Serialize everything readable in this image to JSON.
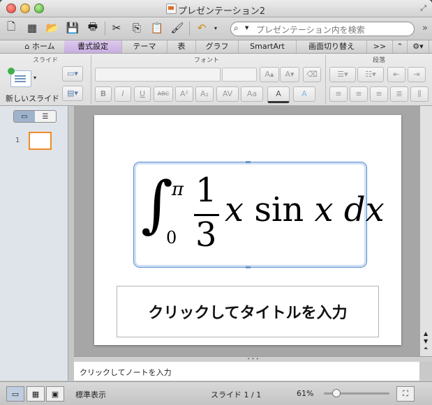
{
  "window": {
    "title": "プレゼンテーション2"
  },
  "toolbar": {
    "search_placeholder": "プレゼンテーション内を検索",
    "more_glyph": "»"
  },
  "tabs": [
    {
      "label": "ホーム"
    },
    {
      "label": "書式設定"
    },
    {
      "label": "テーマ"
    },
    {
      "label": "表"
    },
    {
      "label": "グラフ"
    },
    {
      "label": "SmartArt"
    },
    {
      "label": "画面切り替え"
    },
    {
      "label": ">>"
    }
  ],
  "ribbon": {
    "slides_group": "スライド",
    "font_group": "フォント",
    "paragraph_group": "段落",
    "new_slide_label": "新しいスライド",
    "font_buttons": [
      "B",
      "I",
      "U",
      "ABC",
      "A²",
      "A₂",
      "AV",
      "Aa",
      "A",
      "A"
    ]
  },
  "slide_panel": {
    "slide_number": "1"
  },
  "slide": {
    "equation": {
      "upper": "π",
      "lower": "0",
      "num": "1",
      "den": "3",
      "expr_x": "x",
      "expr_sin": "sin",
      "expr_x2": "x",
      "expr_dx": "dx"
    },
    "title_placeholder": "クリックしてタイトルを入力"
  },
  "notes": {
    "placeholder": "クリックしてノートを入力"
  },
  "statusbar": {
    "view_name": "標準表示",
    "slide_label": "スライド",
    "slide_current": "1",
    "slide_sep": "/",
    "slide_total": "1",
    "zoom": "61%",
    "zoom_value": 0.3
  }
}
